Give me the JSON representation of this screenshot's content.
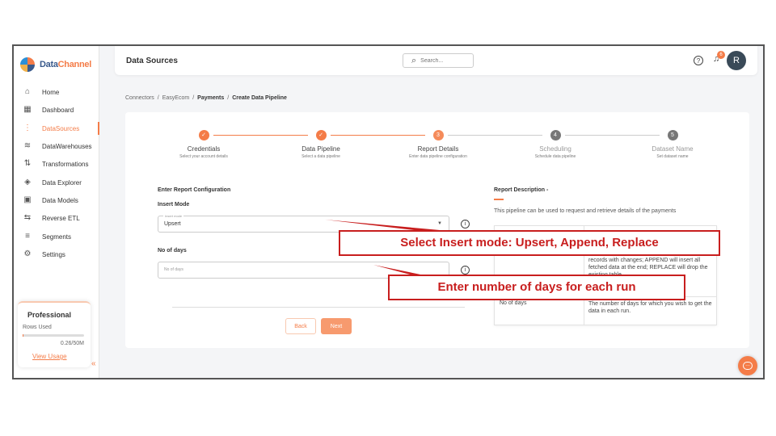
{
  "app": {
    "brand_first": "Data",
    "brand_second": "Channel"
  },
  "sidebar": {
    "items": [
      {
        "label": "Home",
        "icon": "home-icon",
        "glyph": "⌂"
      },
      {
        "label": "Dashboard",
        "icon": "dashboard-icon",
        "glyph": "▦"
      },
      {
        "label": "DataSources",
        "icon": "datasources-icon",
        "glyph": "⋮"
      },
      {
        "label": "DataWarehouses",
        "icon": "datawarehouse-icon",
        "glyph": "≋"
      },
      {
        "label": "Transformations",
        "icon": "transformations-icon",
        "glyph": "⇅"
      },
      {
        "label": "Data Explorer",
        "icon": "explorer-icon",
        "glyph": "◈"
      },
      {
        "label": "Data Models",
        "icon": "models-icon",
        "glyph": "▣"
      },
      {
        "label": "Reverse ETL",
        "icon": "reverse-etl-icon",
        "glyph": "⇆"
      },
      {
        "label": "Segments",
        "icon": "segments-icon",
        "glyph": "≡"
      },
      {
        "label": "Settings",
        "icon": "settings-icon",
        "glyph": "⚙"
      }
    ],
    "plan": {
      "name": "Professional",
      "rows_label": "Rows Used",
      "usage": "0.26/50M",
      "usage_fraction": 0.0052,
      "view_label": "View Usage"
    },
    "collapse_glyph": "«"
  },
  "header": {
    "title": "Data Sources",
    "search_placeholder": "Search...",
    "notifications": "6",
    "avatar": "R"
  },
  "breadcrumb": [
    "Connectors",
    "/",
    "EasyEcom",
    "/",
    "Payments",
    "/",
    "Create Data Pipeline"
  ],
  "steps": [
    {
      "title": "Credentials",
      "sub": "Select your account details",
      "state": "done",
      "mark": "✓"
    },
    {
      "title": "Data Pipeline",
      "sub": "Select a data pipeline",
      "state": "done",
      "mark": "✓"
    },
    {
      "title": "Report Details",
      "sub": "Enter data pipeline configuration",
      "state": "current",
      "mark": "3"
    },
    {
      "title": "Scheduling",
      "sub": "Schedule data pipeline",
      "state": "todo",
      "mark": "4"
    },
    {
      "title": "Dataset Name",
      "sub": "Set dataset name",
      "state": "todo",
      "mark": "5"
    }
  ],
  "form": {
    "section_title": "Enter Report Configuration",
    "insert_mode_label": "Insert Mode",
    "insert_mode_field_label": "Insert mode",
    "insert_mode_value": "Upsert",
    "days_label": "No of days",
    "days_placeholder": "No of days",
    "back": "Back",
    "next": "Next"
  },
  "description": {
    "title": "Report Description -",
    "text": "This pipeline can be used to request and retrieve details of the payments",
    "rows": [
      {
        "name": "",
        "desc": "records with changes; APPEND will insert all fetched data at the end; REPLACE will drop the existing table"
      },
      {
        "name": "No of days",
        "desc": "The number of days for which you wish to get the data in each run."
      }
    ]
  },
  "annotations": {
    "insert_mode": "Select Insert mode: Upsert, Append, Replace",
    "days": "Enter number of days for each run"
  },
  "colors": {
    "accent": "#f47c48",
    "annotation": "#c81e1e"
  }
}
